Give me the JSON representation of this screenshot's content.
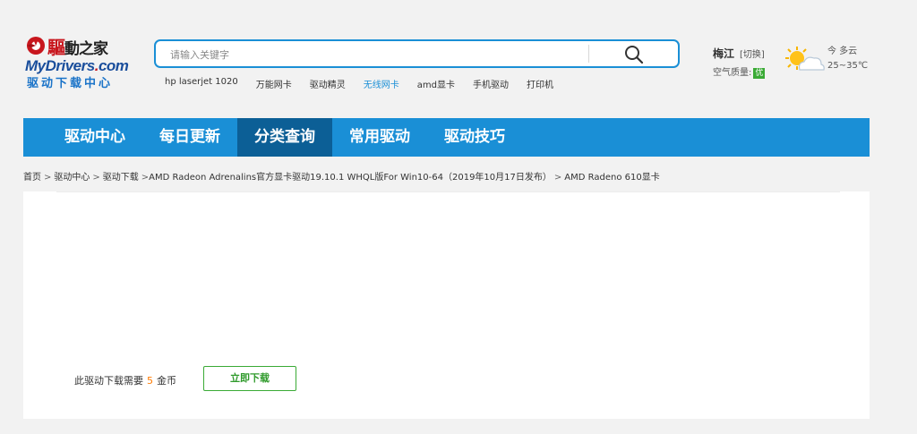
{
  "logo": {
    "cn_first": "驅",
    "cn_rest": "動之家",
    "en_main": "MyDrivers",
    "en_dot": ".",
    "en_tail": "com",
    "sub": "驱动下载中心"
  },
  "search": {
    "placeholder": "请输入关键字",
    "value": ""
  },
  "hotwords": [
    {
      "label": "hp laserjet 1020",
      "highlight": false
    },
    {
      "label": "万能网卡",
      "highlight": false
    },
    {
      "label": "驱动精灵",
      "highlight": false
    },
    {
      "label": "无线网卡",
      "highlight": true
    },
    {
      "label": "amd显卡",
      "highlight": false
    },
    {
      "label": "手机驱动",
      "highlight": false
    },
    {
      "label": "打印机",
      "highlight": false
    }
  ],
  "location": {
    "city": "梅江",
    "switch_label": "[切换]",
    "air_quality_label": "空气质量:",
    "air_quality_value": "优"
  },
  "weather": {
    "icon": "sun-cloud-icon",
    "line1": "今 多云",
    "line2": "25~35℃"
  },
  "nav": {
    "items": [
      {
        "label": "驱动中心",
        "active": false
      },
      {
        "label": "每日更新",
        "active": false
      },
      {
        "label": "分类查询",
        "active": true
      },
      {
        "label": "常用驱动",
        "active": false
      },
      {
        "label": "驱动技巧",
        "active": false
      }
    ]
  },
  "breadcrumb": {
    "items": [
      "首页",
      "驱动中心",
      "驱动下载",
      "AMD Radeon Adrenalins官方显卡驱动19.10.1 WHQL版For Win10-64（2019年10月17日发布）",
      "AMD Radeno 610显卡"
    ],
    "separator": ">"
  },
  "download": {
    "prefix": "此驱动下载需要",
    "coins": "5",
    "suffix": "金币",
    "button_label": "立即下载"
  },
  "colors": {
    "primary_blue": "#1a8fd6",
    "nav_active": "#0c5f96",
    "green": "#3aaa35",
    "coin_orange": "#ff7a00"
  }
}
